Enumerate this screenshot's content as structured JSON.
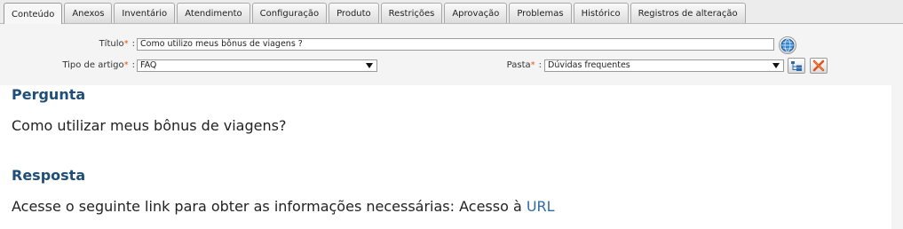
{
  "tabs": [
    {
      "label": "Conteúdo",
      "active": true
    },
    {
      "label": "Anexos"
    },
    {
      "label": "Inventário"
    },
    {
      "label": "Atendimento"
    },
    {
      "label": "Configuração"
    },
    {
      "label": "Produto"
    },
    {
      "label": "Restrições"
    },
    {
      "label": "Aprovação"
    },
    {
      "label": "Problemas"
    },
    {
      "label": "Histórico"
    },
    {
      "label": "Registros de alteração"
    }
  ],
  "form": {
    "title_label": "Título",
    "title_value": "Como utilizo meus bônus de viagens ?",
    "type_label": "Tipo de artigo",
    "type_value": "FAQ",
    "folder_label": "Pasta",
    "folder_value": "Dúvidas frequentes",
    "required_mark": "*",
    "colon": ":"
  },
  "article": {
    "question_heading": "Pergunta",
    "question_text": "Como utilizar meus bônus de viagens?",
    "answer_heading": "Resposta",
    "answer_text": "Acesse o seguinte link para obter as informações necessárias: Acesso à ",
    "answer_link": "URL"
  },
  "colors": {
    "heading": "#1f4e79",
    "link": "#2e6da4",
    "required": "#e06010"
  },
  "icons": {
    "globe": "globe-icon",
    "folder_tree": "folder-tree-icon",
    "clear": "clear-icon"
  }
}
